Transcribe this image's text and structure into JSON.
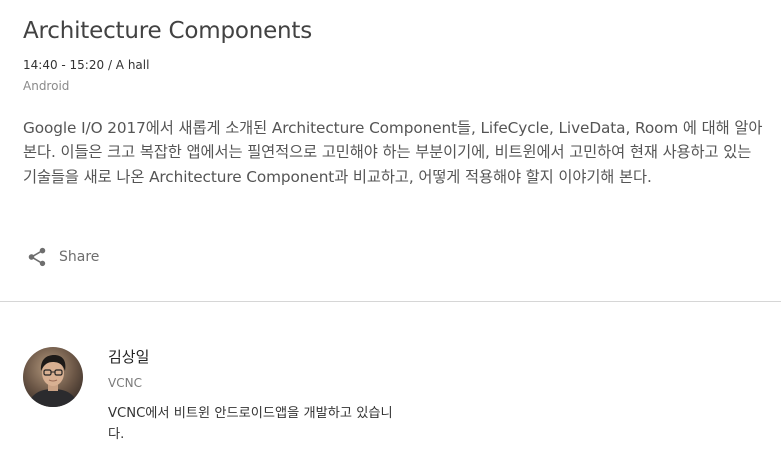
{
  "session": {
    "title": "Architecture Components",
    "time": "14:40 - 15:20 / A hall",
    "track": "Android",
    "description": "Google I/O 2017에서 새롭게 소개된 Architecture Component들, LifeCycle, LiveData, Room 에 대해 알아본다. 이들은 크고 복잡한 앱에서는 필연적으로 고민해야 하는 부분이기에, 비트윈에서 고민하여 현재 사용하고 있는 기술들을 새로 나온 Architecture Component과 비교하고, 어떻게 적용해야 할지 이야기해 본다."
  },
  "actions": {
    "share_label": "Share",
    "share_icon": "share-icon"
  },
  "speaker": {
    "name": "김상일",
    "company": "VCNC",
    "bio": "VCNC에서 비트윈 안드로이드앱을 개발하고 있습니다."
  },
  "colors": {
    "title": "#424242",
    "body_text": "#555555",
    "muted": "#8a8a8a",
    "divider": "#d6d6d6"
  }
}
